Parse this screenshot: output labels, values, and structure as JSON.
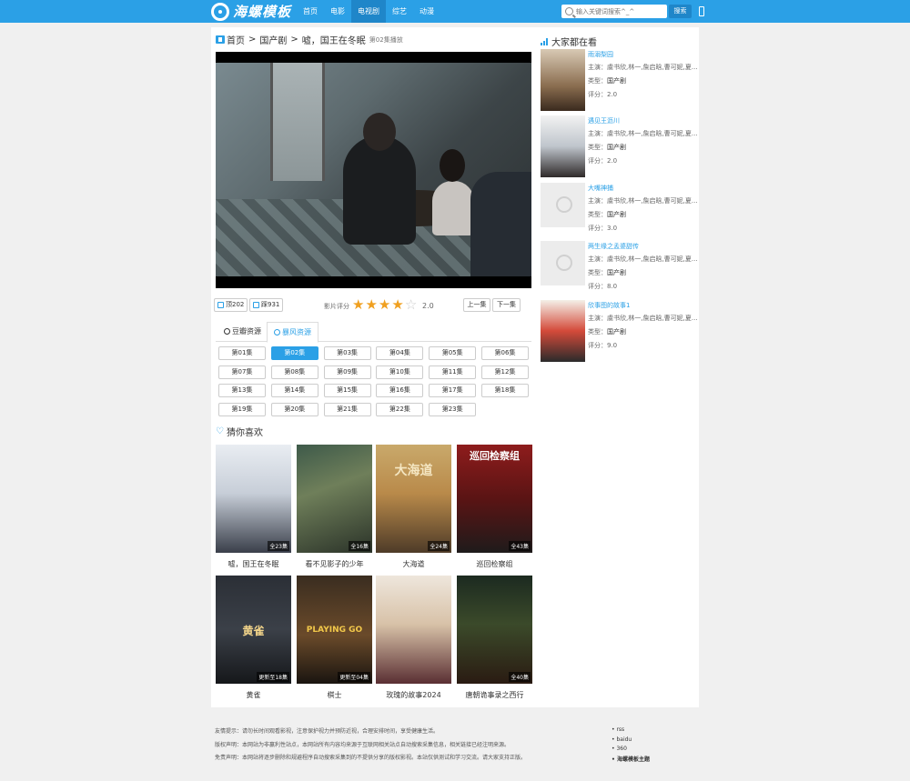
{
  "brand": {
    "logo_text": "海螺模板"
  },
  "nav": {
    "items": [
      "首页",
      "电影",
      "电视剧",
      "综艺",
      "动漫"
    ],
    "active_index": 2
  },
  "search": {
    "placeholder": "输入关键词搜索^_^",
    "button_label": "搜索"
  },
  "breadcrumb": {
    "home": "首页",
    "category": "国产剧",
    "title": "嘘，国王在冬眠",
    "current": "第02集播放"
  },
  "votes": {
    "up_label": "顶202",
    "down_label": "踩931"
  },
  "rating": {
    "label": "影片评分",
    "value": "2.0",
    "stars_filled": 4,
    "stars_total": 5
  },
  "episode_nav": {
    "prev": "上一集",
    "next": "下一集"
  },
  "tabs": [
    {
      "label": "豆瓣资源",
      "icon": "circle-play-icon"
    },
    {
      "label": "暴风资源",
      "icon": "circle-play-icon"
    }
  ],
  "active_tab": 1,
  "episodes": [
    "第01集",
    "第02集",
    "第03集",
    "第04集",
    "第05集",
    "第06集",
    "第07集",
    "第08集",
    "第09集",
    "第10集",
    "第11集",
    "第12集",
    "第13集",
    "第14集",
    "第15集",
    "第16集",
    "第17集",
    "第18集",
    "第19集",
    "第20集",
    "第21集",
    "第22集",
    "第23集"
  ],
  "active_episode": 1,
  "recommend": {
    "title": "猜你喜欢",
    "items": [
      {
        "title": "嘘，国王在冬眠",
        "badge": "全23集"
      },
      {
        "title": "看不见影子的少年",
        "badge": "全16集"
      },
      {
        "title": "大海道",
        "badge": "全24集"
      },
      {
        "title": "巡回检察组",
        "badge": "全43集"
      },
      {
        "title": "黄雀",
        "badge": "更新至18集"
      },
      {
        "title": "棋士",
        "badge": "更新至04集"
      },
      {
        "title": "玫瑰的故事2024",
        "badge": ""
      },
      {
        "title": "唐朝诡事录之西行",
        "badge": "全40集"
      }
    ],
    "poster_texts": [
      "",
      "",
      "大海道",
      "巡回检察组",
      "黄雀",
      "PLAYING GO",
      "",
      ""
    ]
  },
  "sidebar": {
    "title": "大家都在看",
    "cast_label": "主演：",
    "type_label": "类型：",
    "score_label": "评分：",
    "items": [
      {
        "name": "雨溺梨园",
        "cast": "虞书欣,林一,詹启晗,曹可妮,夏...",
        "type": "国产剧",
        "score": "2.0"
      },
      {
        "name": "遇见王沥川",
        "cast": "虞书欣,林一,詹启晗,曹可妮,夏...",
        "type": "国产剧",
        "score": "2.0"
      },
      {
        "name": "大嘴神捕",
        "cast": "虞书欣,林一,詹启晗,曹可妮,夏...",
        "type": "国产剧",
        "score": "3.0"
      },
      {
        "name": "两生缘之孟婆甜传",
        "cast": "虞书欣,林一,詹启晗,曹可妮,夏...",
        "type": "国产剧",
        "score": "8.0"
      },
      {
        "name": "欣事图的故事1",
        "cast": "虞书欣,林一,詹启晗,曹可妮,夏...",
        "type": "国产剧",
        "score": "9.0"
      }
    ]
  },
  "footer": {
    "lines": [
      "友情提示：请勿长时间观看影视，注意保护视力并预防近视，合理安排时间，享受健康生活。",
      "版权声明：本网站为非赢利性站点，本网站所有内容均来源于互联网相关站点自动搜索采集信息，相关链接已经注明来源。",
      "免责声明：本网站将逐步删除和规避程序自动搜索采集到的不提供分享的版权影视。本站仅供测试和学习交流。请大家支持正版。"
    ],
    "links": [
      "rss",
      "baidu",
      "360",
      "海螺模板主题"
    ]
  },
  "colors": {
    "accent": "#2ba0e6",
    "nav_active": "#1f86c9",
    "star": "#f0a020"
  }
}
